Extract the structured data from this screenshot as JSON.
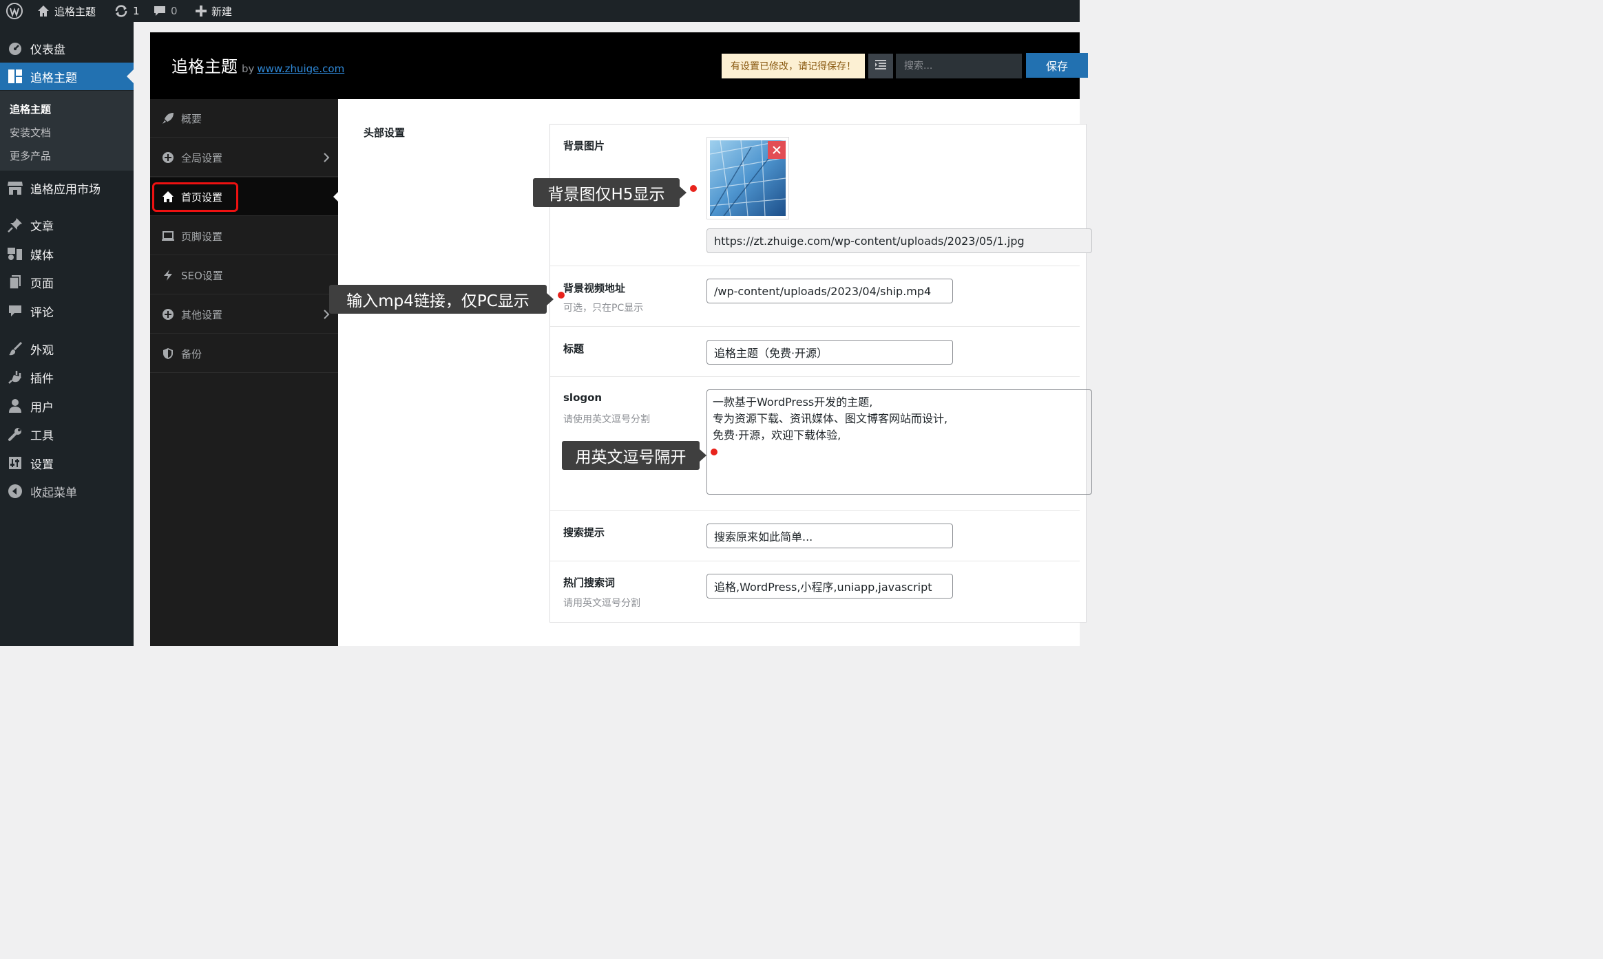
{
  "adminbar": {
    "site_name": "追格主题",
    "updates_count": "1",
    "comments_count": "0",
    "new_label": "新建"
  },
  "menu": {
    "dashboard": "仪表盘",
    "theme": "追格主题",
    "submenu": [
      "追格主题",
      "安装文档",
      "更多产品"
    ],
    "app_market": "追格应用市场",
    "posts": "文章",
    "media": "媒体",
    "pages": "页面",
    "comments": "评论",
    "appearance": "外观",
    "plugins": "插件",
    "users": "用户",
    "tools": "工具",
    "settings": "设置",
    "collapse": "收起菜单"
  },
  "header": {
    "title": "追格主题",
    "by": "by",
    "link_text": "www.zhuige.com",
    "notice": "有设置已修改，请记得保存！",
    "search_placeholder": "搜索...",
    "save_label": "保存"
  },
  "nav": {
    "items": [
      "概要",
      "全局设置",
      "首页设置",
      "页脚设置",
      "SEO设置",
      "其他设置",
      "备份"
    ]
  },
  "section": {
    "title": "头部设置"
  },
  "fields": {
    "bg_image": {
      "label": "背景图片",
      "url": "https://zt.zhuige.com/wp-content/uploads/2023/05/1.jpg"
    },
    "bg_video": {
      "label": "背景视频地址",
      "desc": "可选，只在PC显示",
      "value": "/wp-content/uploads/2023/04/ship.mp4"
    },
    "title": {
      "label": "标题",
      "value": "追格主题（免费·开源）"
    },
    "slogon": {
      "label": "slogon",
      "desc": "请使用英文逗号分割",
      "lines": [
        "一款基于WordPress开发的主题,",
        "专为资源下载、资讯媒体、图文博客网站而设计,",
        "免费·开源，欢迎下载体验,"
      ]
    },
    "search_hint": {
      "label": "搜索提示",
      "value": "搜索原来如此简单..."
    },
    "hot_keywords": {
      "label": "热门搜索词",
      "desc": "请用英文逗号分割",
      "value": "追格,WordPress,小程序,uniapp,javascript"
    }
  },
  "annotations": {
    "bg_image": "背景图仅H5显示",
    "bg_video": "输入mp4链接，仅PC显示",
    "slogon": "用英文逗号隔开"
  },
  "colors": {
    "accent": "#2271b1",
    "highlight": "#e11111",
    "annotation_dot": "#e8231c"
  }
}
